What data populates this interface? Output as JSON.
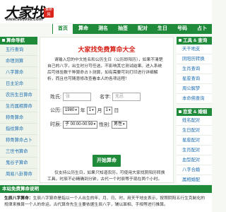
{
  "brand": {
    "logo_text": "大家找",
    "badge_text": "算命网",
    "url": "www.966998.com"
  },
  "nav": {
    "items": [
      "首页",
      "算命",
      "测名",
      "抽签",
      "配对",
      "生日",
      "号码",
      "占卜"
    ],
    "active_index": 0
  },
  "left_sidebar": {
    "heading": "算命导航",
    "items": [
      "五行查询",
      "命理测算",
      "八字算命",
      "日主论命",
      "农历生日算命",
      "生肖属相算命",
      "称骨算命",
      "指纹算命",
      "称骨算命占卜",
      "三世书算命",
      "鬼谷子算命",
      "周易八卦算命"
    ]
  },
  "main": {
    "title": "大家找免费算命大全",
    "intro": "请输入您的中文姓名和公历生日（公历即阳历），如果不清楚自己的八字，出生时分可任选，不影响其它测试结果。进入系统后可体验数千种算命占卜测算，如有需要可到打印进行详细解析，而且也可随意修改查看本人的各项运程！",
    "form": {
      "surname_label": "姓氏:",
      "surname_placeholder": "张",
      "name_label": "名字:",
      "name_placeholder": "无忌",
      "gregorian_label": "公历:",
      "year": "1980",
      "year_unit": "年",
      "month": "1",
      "month_unit": "月",
      "day": "1",
      "day_unit": "日",
      "time_label": "时辰:",
      "time_value": "子 00:00-00:59",
      "gender_label": "性别:",
      "gender_value": "男性"
    },
    "submit_label": "开始算命",
    "note": "仅支持公历生日，如果只知道农历，可使用大家找阴阳历转换工具。时辰不必精确到分钟，古代一个时辰等于现在两个小时。"
  },
  "right_sidebar": {
    "tools": {
      "heading": "工具 & 查询",
      "items": [
        "天干地支",
        "阴阳历转换",
        "生肖查询",
        "星座查询",
        "周公解梦",
        "本命佛查询"
      ]
    },
    "love": {
      "heading": "恋爱 & 婚姻",
      "items": [
        "姓名配对",
        "生日配对",
        "星座配对",
        "生肖配对",
        "血型配对",
        "八字合婚",
        "属相婚配"
      ]
    }
  },
  "bottom": {
    "heading": "本站免费算命说明",
    "title": "生辰八字算命：",
    "text": "生辰八字算命是指以一个人出生的年、月、日、时，用天干地支表示，按照阴阳五行生克制化的规律来推算一个人的命运。古代算命先生主要依据生辰八字，辅以面相、手相等进行推算。"
  },
  "colors": {
    "primary_green": "#1f8a3a",
    "title_red": "#d9241b",
    "link_blue": "#1f6fb2"
  }
}
